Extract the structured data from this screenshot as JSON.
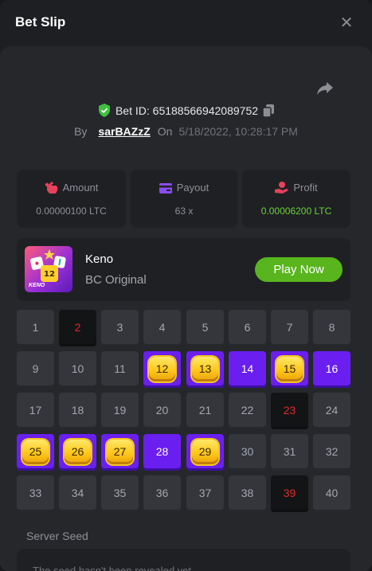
{
  "header": {
    "title": "Bet Slip"
  },
  "bet": {
    "id_label": "Bet ID: 6518856694208975​2",
    "by_label": "By",
    "username": "sarBAZzZ",
    "on_label": "On",
    "date": "5/18/2022, 10:28:17 PM"
  },
  "stats": [
    {
      "label": "Amount",
      "value": "0.00000100 LTC",
      "icon": "money-bag-icon",
      "color": "#e8415b"
    },
    {
      "label": "Payout",
      "value": "63 x",
      "icon": "card-icon",
      "color": "#8a4cf2"
    },
    {
      "label": "Profit",
      "value": "0.00006200 LTC",
      "icon": "hand-coin-icon",
      "color": "#e8415b"
    }
  ],
  "game": {
    "name": "Keno",
    "subtitle": "BC Original",
    "thumb_text": "KENO",
    "play_label": "Play Now",
    "accent": "#59b51e"
  },
  "board": {
    "tiles": [
      {
        "n": "1",
        "s": "n"
      },
      {
        "n": "2",
        "s": "m"
      },
      {
        "n": "3",
        "s": "n"
      },
      {
        "n": "4",
        "s": "n"
      },
      {
        "n": "5",
        "s": "n"
      },
      {
        "n": "6",
        "s": "n"
      },
      {
        "n": "7",
        "s": "n"
      },
      {
        "n": "8",
        "s": "n"
      },
      {
        "n": "9",
        "s": "n"
      },
      {
        "n": "10",
        "s": "n"
      },
      {
        "n": "11",
        "s": "n"
      },
      {
        "n": "12",
        "s": "h"
      },
      {
        "n": "13",
        "s": "h"
      },
      {
        "n": "14",
        "s": "p"
      },
      {
        "n": "15",
        "s": "h"
      },
      {
        "n": "16",
        "s": "p"
      },
      {
        "n": "17",
        "s": "n"
      },
      {
        "n": "18",
        "s": "n"
      },
      {
        "n": "19",
        "s": "n"
      },
      {
        "n": "20",
        "s": "n"
      },
      {
        "n": "21",
        "s": "n"
      },
      {
        "n": "22",
        "s": "n"
      },
      {
        "n": "23",
        "s": "m"
      },
      {
        "n": "24",
        "s": "n"
      },
      {
        "n": "25",
        "s": "h"
      },
      {
        "n": "26",
        "s": "h"
      },
      {
        "n": "27",
        "s": "h"
      },
      {
        "n": "28",
        "s": "p"
      },
      {
        "n": "29",
        "s": "h"
      },
      {
        "n": "30",
        "s": "n"
      },
      {
        "n": "31",
        "s": "n"
      },
      {
        "n": "32",
        "s": "n"
      },
      {
        "n": "33",
        "s": "n"
      },
      {
        "n": "34",
        "s": "n"
      },
      {
        "n": "35",
        "s": "n"
      },
      {
        "n": "36",
        "s": "n"
      },
      {
        "n": "37",
        "s": "n"
      },
      {
        "n": "38",
        "s": "n"
      },
      {
        "n": "39",
        "s": "m"
      },
      {
        "n": "40",
        "s": "n"
      }
    ]
  },
  "seed": {
    "label": "Server Seed",
    "text": "The seed hasn't been revealed yet"
  }
}
